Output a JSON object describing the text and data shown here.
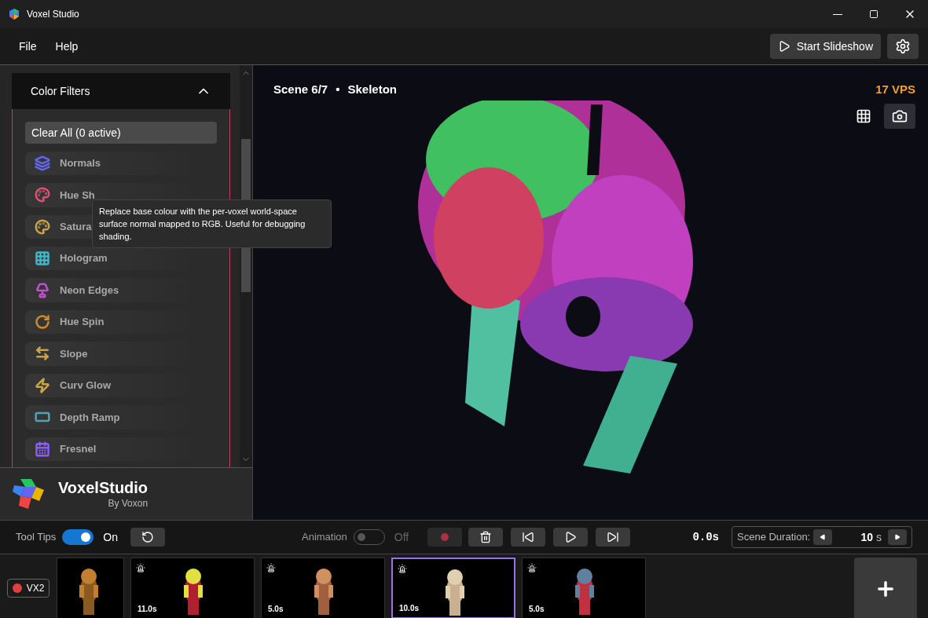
{
  "window": {
    "title": "Voxel Studio"
  },
  "menu": [
    "File",
    "Help"
  ],
  "toolbar": {
    "slideshow": "Start Slideshow"
  },
  "filters": {
    "title": "Color Filters",
    "expanded": true,
    "clear": "Clear All (0 active)",
    "items": [
      {
        "label": "Normals",
        "color": "#6366f1"
      },
      {
        "label": "Hue Sh",
        "color": "#d9536f"
      },
      {
        "label": "Satura",
        "color": "#c9a24a"
      },
      {
        "label": "Hologram",
        "color": "#3fb6c6"
      },
      {
        "label": "Neon Edges",
        "color": "#c04fd0"
      },
      {
        "label": "Hue Spin",
        "color": "#d08a2a"
      },
      {
        "label": "Slope",
        "color": "#c9a24a"
      },
      {
        "label": "Curv Glow",
        "color": "#c9a24a"
      },
      {
        "label": "Depth Ramp",
        "color": "#4fa3b5"
      },
      {
        "label": "Fresnel",
        "color": "#8b5cf6"
      }
    ],
    "tooltip": "Replace base colour with the per-voxel world-space surface normal mapped to RGB. Useful for debugging shading."
  },
  "brand": {
    "name": "VoxelStudio",
    "by": "By Voxon"
  },
  "viewport": {
    "scene": "Scene 6/7",
    "separator": "•",
    "name": "Skeleton",
    "rate": "17 VPS"
  },
  "controls": {
    "tooltips_label": "Tool Tips",
    "tooltips_on": true,
    "tooltips_state": "On",
    "animation_label": "Animation",
    "animation_on": false,
    "animation_state": "Off",
    "time": "0.0s",
    "duration_label": "Scene Duration:",
    "duration_value": "10",
    "duration_unit": "s"
  },
  "device": {
    "label": "VX2"
  },
  "thumbnails": [
    {
      "selected": false
    },
    {
      "duration": "11.0s",
      "selected": false
    },
    {
      "duration": "5.0s",
      "selected": false
    },
    {
      "duration": "10.0s",
      "selected": true
    },
    {
      "duration": "5.0s",
      "selected": false
    }
  ]
}
